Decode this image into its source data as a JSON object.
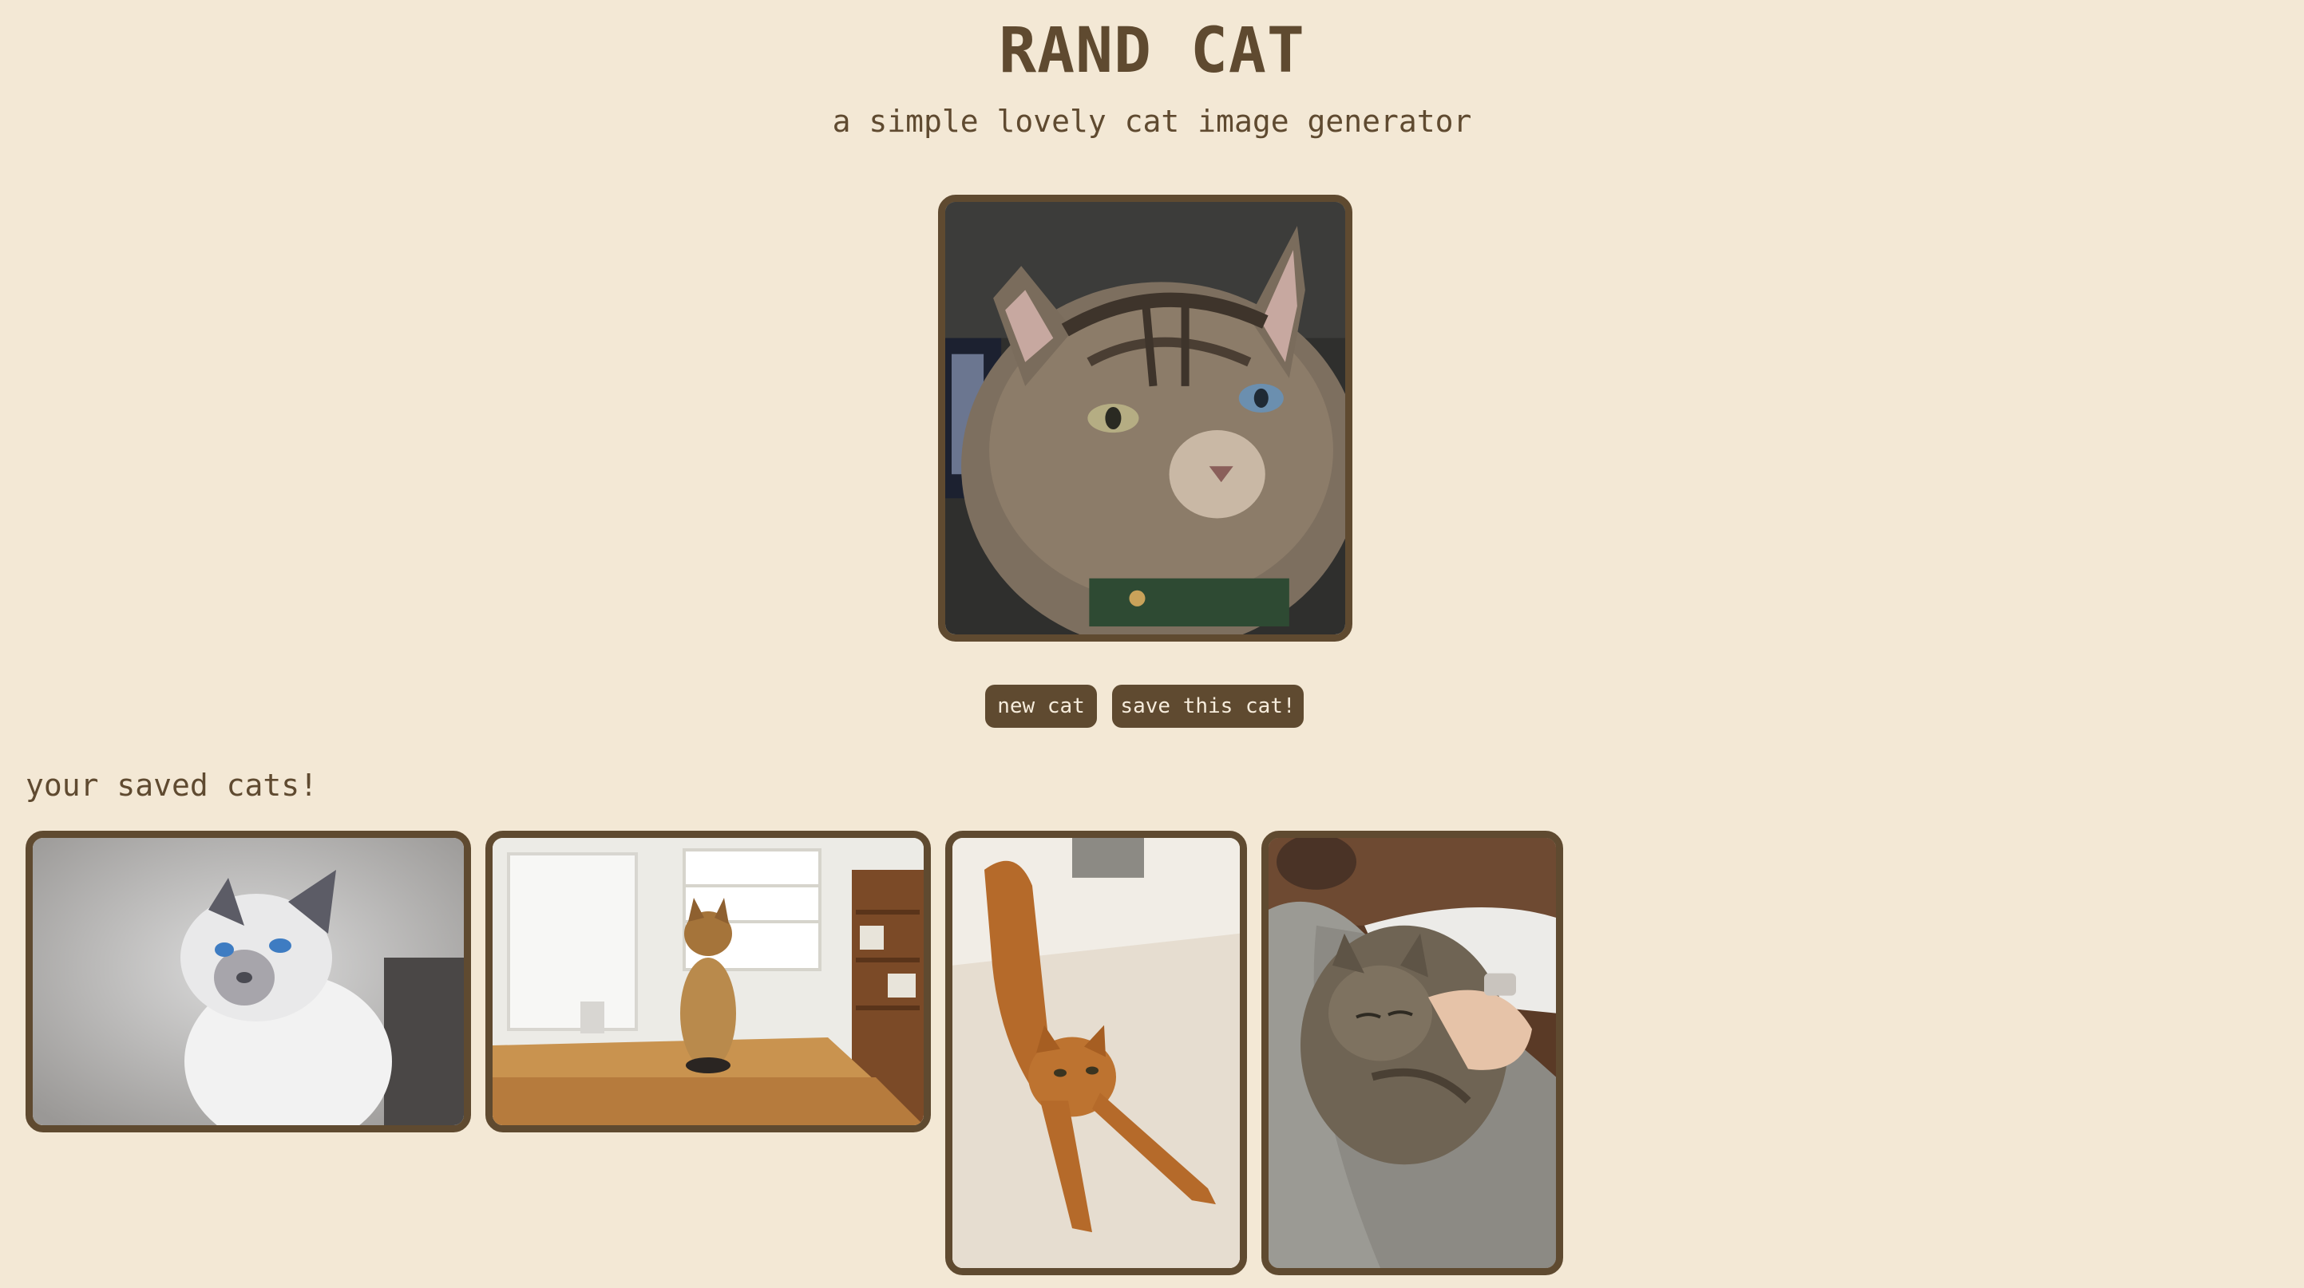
{
  "header": {
    "title": "RAND CAT",
    "subtitle": "a simple lovely cat image generator"
  },
  "current_cat": {
    "image": "tabby-cat-closeup-photo"
  },
  "buttons": {
    "new_cat": "new cat",
    "save_cat": "save this cat!"
  },
  "saved": {
    "heading": "your saved cats!",
    "items": [
      {
        "image": "white-siamese-cat-blue-eyes-photo"
      },
      {
        "image": "bengal-cat-on-kitchen-table-photo"
      },
      {
        "image": "orange-cat-stretching-photo"
      },
      {
        "image": "tabby-cat-sleeping-on-person-photo"
      }
    ]
  },
  "colors": {
    "background": "#f3e8d5",
    "accent": "#5f4a30",
    "button_text": "#f6ecdc"
  }
}
